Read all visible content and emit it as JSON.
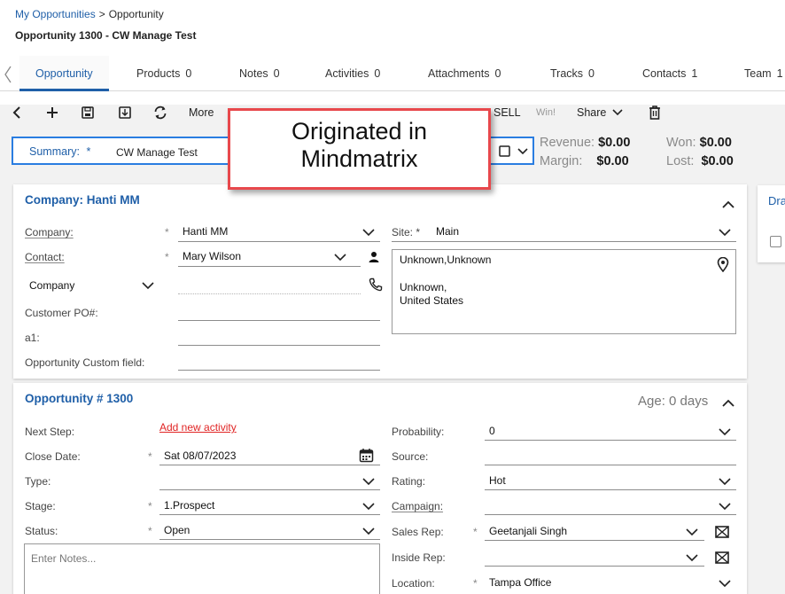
{
  "breadcrumb": {
    "parent": "My Opportunities",
    "separator": ">",
    "current": "Opportunity"
  },
  "record_title": "Opportunity 1300 - CW Manage Test",
  "tabs": [
    {
      "label": "Opportunity",
      "count": ""
    },
    {
      "label": "Products",
      "count": "0"
    },
    {
      "label": "Notes",
      "count": "0"
    },
    {
      "label": "Activities",
      "count": "0"
    },
    {
      "label": "Attachments",
      "count": "0"
    },
    {
      "label": "Tracks",
      "count": "0"
    },
    {
      "label": "Contacts",
      "count": "1"
    },
    {
      "label": "Team",
      "count": "1"
    }
  ],
  "toolbar": {
    "more_label": "More",
    "sell_label": "SELL",
    "win_label": "Win!",
    "share_label": "Share"
  },
  "summary": {
    "label": "Summary:",
    "required_mark": "*",
    "value": "CW Manage Test"
  },
  "totals": {
    "revenue_label": "Revenue:",
    "revenue_value": "$0.00",
    "won_label": "Won:",
    "won_value": "$0.00",
    "margin_label": "Margin:",
    "margin_value": "$0.00",
    "lost_label": "Lost:",
    "lost_value": "$0.00"
  },
  "callout": {
    "line1": "Originated in",
    "line2": "Mindmatrix"
  },
  "company_panel": {
    "title": "Company: Hanti MM",
    "company_label": "Company:",
    "company_value": "Hanti MM",
    "contact_label": "Contact:",
    "contact_value": "Mary Wilson",
    "phone_type": "Company",
    "customer_po_label": "Customer PO#:",
    "a1_label": "a1:",
    "custom_field_label": "Opportunity Custom field:",
    "site_label": "Site:",
    "site_required": "*",
    "site_value": "Main",
    "address_line1": "Unknown,Unknown",
    "address_line2": "Unknown,",
    "address_line3": "United States"
  },
  "side_panel": {
    "title_fragment": "Dra"
  },
  "opportunity_panel": {
    "title": "Opportunity # 1300",
    "age": "Age: 0 days",
    "next_step_label": "Next Step:",
    "add_activity_link": "Add new activity",
    "close_date_label": "Close Date:",
    "close_date_value": "Sat 08/07/2023",
    "type_label": "Type:",
    "stage_label": "Stage:",
    "stage_value": "1.Prospect",
    "status_label": "Status:",
    "status_value": "Open",
    "notes_placeholder": "Enter Notes...",
    "probability_label": "Probability:",
    "probability_value": "0",
    "source_label": "Source:",
    "rating_label": "Rating:",
    "rating_value": "Hot",
    "campaign_label": "Campaign:",
    "sales_rep_label": "Sales Rep:",
    "sales_rep_value": "Geetanjali Singh",
    "inside_rep_label": "Inside Rep:",
    "location_label": "Location:",
    "location_value": "Tampa Office"
  },
  "colors": {
    "link_blue": "#1f5fa8",
    "focus_blue": "#2a7de1",
    "callout_red": "#e8484c",
    "link_red": "#e02424"
  }
}
